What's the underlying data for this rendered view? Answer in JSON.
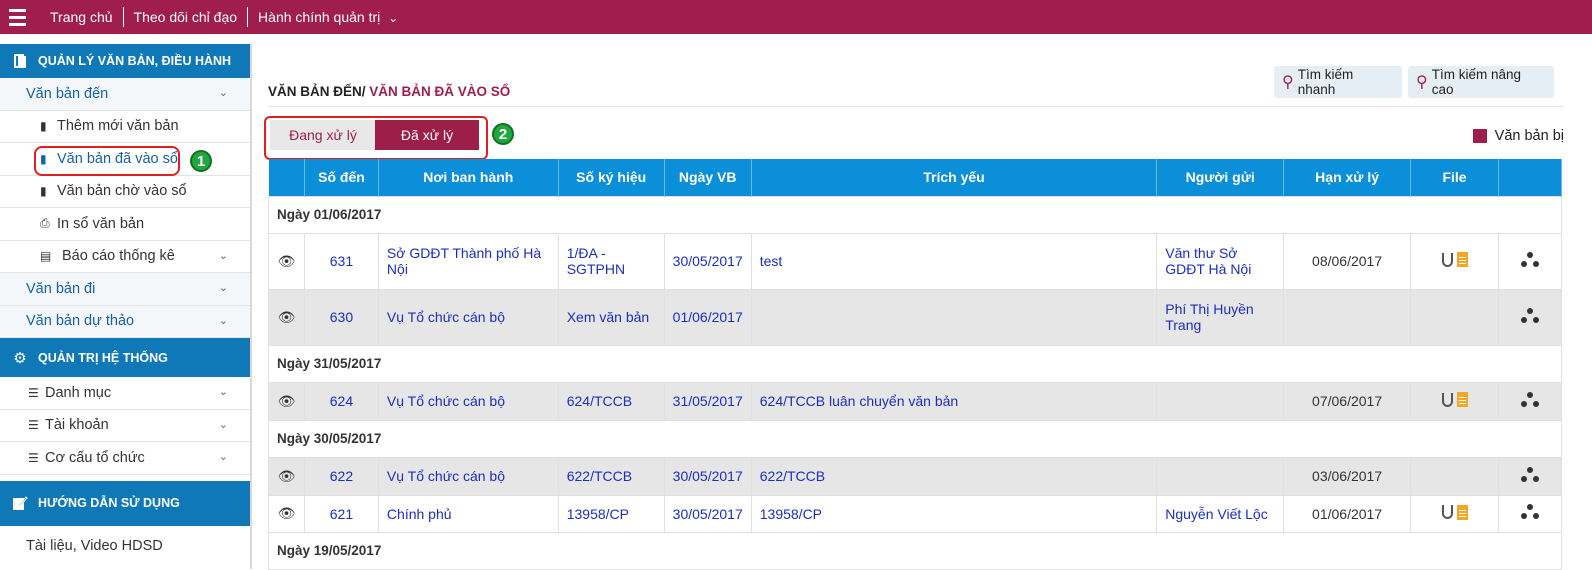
{
  "topbar": {
    "items": [
      "Trang chủ",
      "Theo dõi chỉ đạo",
      "Hành chính quản trị"
    ]
  },
  "sidebar": {
    "section1": "QUẢN LÝ VĂN BẢN, ĐIỀU HÀNH",
    "van_ban_den": "Văn bản đến",
    "them_moi": "Thêm mới văn bản",
    "da_vao_so": "Văn bản đã vào sổ",
    "cho_vao_so": "Văn bản chờ vào sổ",
    "in_so": "In sổ văn bản",
    "bao_cao": "Báo cáo thống kê",
    "van_ban_di": "Văn bản đi",
    "du_thao": "Văn bản dự thảo",
    "section2": "QUẢN TRỊ HỆ THỐNG",
    "danh_muc": "Danh mục",
    "tai_khoan": "Tài khoản",
    "co_cau": "Cơ cấu tổ chức",
    "section3": "HƯỚNG DẪN SỬ DỤNG",
    "tai_lieu": "Tài liệu, Video HDSD",
    "badge1": "1",
    "badge2": "2"
  },
  "main": {
    "breadcrumb_parent": "VĂN BẢN ĐẾN/",
    "breadcrumb_current": " VĂN BẢN ĐÃ VÀO SỔ",
    "quick_search": "Tìm kiếm nhanh",
    "adv_search": "Tìm kiếm nâng cao",
    "tab_processing": "Đang xử lý",
    "tab_processed": "Đã xử lý",
    "legend": "Văn bản bị"
  },
  "table": {
    "headers": [
      "",
      "Số đến",
      "Nơi ban hành",
      "Số ký hiệu",
      "Ngày VB",
      "Trích yếu",
      "Người gửi",
      "Hạn xử lý",
      "File",
      ""
    ],
    "groups": [
      {
        "label": "Ngày 01/06/2017",
        "rows": [
          {
            "so_den": "631",
            "noi_ban_hanh": "Sở GDĐT Thành phố Hà Nội",
            "so_ky_hieu": "1/ĐA - SGTPHN",
            "ngay_vb": "30/05/2017",
            "trich_yeu": "test",
            "nguoi_gui": "Văn thư Sở GDĐT Hà Nội",
            "han_xu_ly": "08/06/2017",
            "file": true,
            "grey": false
          },
          {
            "so_den": "630",
            "noi_ban_hanh": "Vụ Tổ chức cán bộ",
            "so_ky_hieu": "Xem văn bản",
            "ngay_vb": "01/06/2017",
            "trich_yeu": "",
            "nguoi_gui": "Phí Thị Huyền Trang",
            "han_xu_ly": "",
            "file": false,
            "grey": true
          }
        ]
      },
      {
        "label": "Ngày 31/05/2017",
        "rows": [
          {
            "so_den": "624",
            "noi_ban_hanh": "Vụ Tổ chức cán bộ",
            "so_ky_hieu": "624/TCCB",
            "ngay_vb": "31/05/2017",
            "trich_yeu": "624/TCCB luân chuyển văn bản",
            "nguoi_gui": "",
            "han_xu_ly": "07/06/2017",
            "file": true,
            "grey": true
          }
        ]
      },
      {
        "label": "Ngày 30/05/2017",
        "rows": [
          {
            "so_den": "622",
            "noi_ban_hanh": "Vụ Tổ chức cán bộ",
            "so_ky_hieu": "622/TCCB",
            "ngay_vb": "30/05/2017",
            "trich_yeu": "622/TCCB",
            "nguoi_gui": "",
            "han_xu_ly": "03/06/2017",
            "file": false,
            "grey": true
          },
          {
            "so_den": "621",
            "noi_ban_hanh": "Chính phủ",
            "so_ky_hieu": "13958/CP",
            "ngay_vb": "30/05/2017",
            "trich_yeu": "13958/CP",
            "nguoi_gui": "Nguyễn Viết Lộc",
            "han_xu_ly": "01/06/2017",
            "file": true,
            "grey": false
          }
        ]
      },
      {
        "label": "Ngày 19/05/2017",
        "rows": []
      }
    ]
  },
  "colors": {
    "brand": "#a01e4c",
    "header_blue": "#0b8fd9",
    "sidebar_blue": "#0e79b6",
    "link": "#1b2ec0"
  }
}
